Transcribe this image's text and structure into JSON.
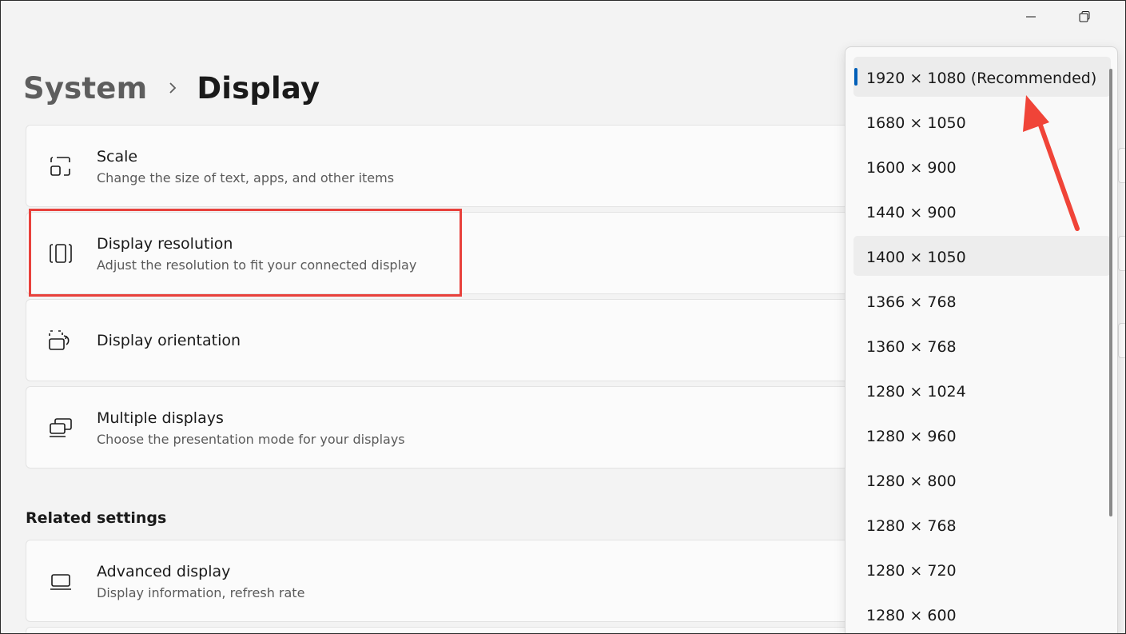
{
  "window": {
    "minimize_icon": "minimize-icon",
    "restore_icon": "restore-icon"
  },
  "breadcrumb": {
    "parent": "System",
    "separator_icon": "chevron-right-icon",
    "current": "Display"
  },
  "cards": {
    "scale": {
      "icon": "scale-icon",
      "title": "Scale",
      "subtitle": "Change the size of text, apps, and other items"
    },
    "resolution": {
      "icon": "resolution-icon",
      "title": "Display resolution",
      "subtitle": "Adjust the resolution to fit your connected display"
    },
    "orientation": {
      "icon": "orientation-icon",
      "title": "Display orientation"
    },
    "multiple": {
      "icon": "multiple-displays-icon",
      "title": "Multiple displays",
      "subtitle": "Choose the presentation mode for your displays"
    },
    "advanced": {
      "icon": "monitor-icon",
      "title": "Advanced display",
      "subtitle": "Display information, refresh rate"
    }
  },
  "related_settings": {
    "heading": "Related settings"
  },
  "resolution_dropdown": {
    "selected": "1920 × 1080 (Recommended)",
    "options": [
      "1920 × 1080 (Recommended)",
      "1680 × 1050",
      "1600 × 900",
      "1440 × 900",
      "1400 × 1050",
      "1366 × 768",
      "1360 × 768",
      "1280 × 1024",
      "1280 × 960",
      "1280 × 800",
      "1280 × 768",
      "1280 × 720",
      "1280 × 600"
    ],
    "hovered_index": 4
  },
  "annotations": {
    "highlight_color": "#e8413c",
    "arrow_color": "#f04438"
  },
  "colors": {
    "accent": "#005fb8"
  }
}
